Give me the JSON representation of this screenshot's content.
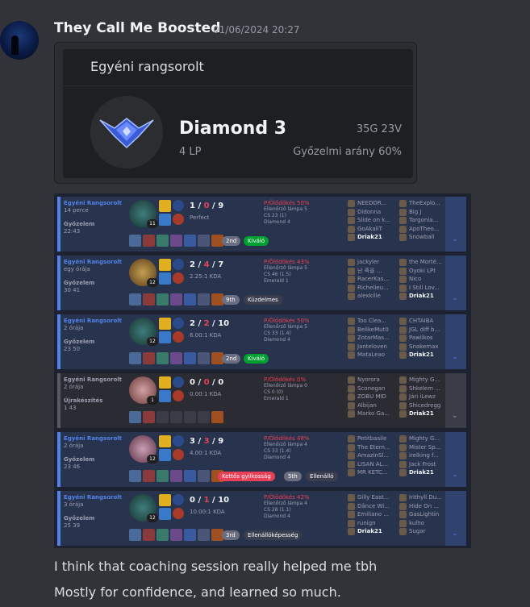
{
  "message": {
    "author": "They Call Me Boosted",
    "timestamp": "01/06/2024 20:27",
    "lines": [
      "I think that coaching session really helped me tbh",
      "Mostly for confidence, and learned so much."
    ]
  },
  "embed": {
    "title": "Egyéni rangsorolt",
    "tier": "Diamond 3",
    "lp": "4 LP",
    "games": "35G 23V",
    "winrate": "Győzelmi arány 60%"
  },
  "colors": {
    "win_accent": "#5383e8",
    "loss_accent": "#59595e",
    "badge_green": "#00a030",
    "kp_red": "#e84057"
  },
  "matches": [
    {
      "queue": "Egyéni Rangsorolt",
      "ago": "14 perce",
      "result": "Győzelem",
      "duration": "22:43",
      "level": "11",
      "k": "1",
      "d": "0",
      "a": "9",
      "ratio": "Perfect",
      "place": "2nd",
      "tag": "Kiváló",
      "tag_style": "green",
      "kp": "P/Ölődökés 50%",
      "line1": "Ellenőrző lámpa 5",
      "line2": "CS 23 (1)",
      "line3": "Diamond 4",
      "team1": [
        "NEEDDR...",
        "Didonna",
        "Slide on k...",
        "GoAkaliT",
        "Driak21"
      ],
      "team2": [
        "TheExplo...",
        "Big J",
        "Targonia...",
        "ApoTheo...",
        "Snowball"
      ]
    },
    {
      "queue": "Egyéni Rangsorolt",
      "ago": "egy órája",
      "result": "Győzelem",
      "duration": "30 41",
      "level": "12",
      "k": "2",
      "d": "4",
      "a": "7",
      "ratio": "2.25:1 KDA",
      "place": "9th",
      "tag": "Küzdelmes",
      "tag_style": "gray",
      "kp": "P/Ölődökés 43%",
      "line1": "Ellenőrző lámpa 5",
      "line2": "CS 46 (1.5)",
      "line3": "Emerald 1",
      "team1": [
        "jackyler",
        "난 죽을 ...",
        "RacerKas...",
        "Richelieu...",
        "alexkille"
      ],
      "team2": [
        "the Morté...",
        "Oyoki LPt",
        "Nico",
        "I Still Lov...",
        "Driak21"
      ]
    },
    {
      "queue": "Egyéni Rangsorolt",
      "ago": "2 órája",
      "result": "Győzelem",
      "duration": "23 50",
      "level": "12",
      "k": "2",
      "d": "2",
      "a": "10",
      "ratio": "6.00:1 KDA",
      "place": "2nd",
      "tag": "Kiváló",
      "tag_style": "green",
      "kp": "P/Ölődökés 50%",
      "line1": "Ellenőrző lámpa 5",
      "line2": "CS 33 (1.4)",
      "line3": "Diamond 4",
      "team1": [
        "Too Clea...",
        "BelikeMut0",
        "ZotarMas...",
        "Janteloven",
        "MataLeao"
      ],
      "team2": [
        "CHTAIBA",
        "JGL diff b...",
        "Pawlikos",
        "Snakemax",
        "Driak21"
      ]
    },
    {
      "queue": "Egyéni Rangsorolt",
      "ago": "2 órája",
      "result": "Újrakészítés",
      "duration": "1 43",
      "level": "1",
      "k": "0",
      "d": "0",
      "a": "0",
      "ratio": "0.00:1 KDA",
      "place": "",
      "tag": "",
      "tag_style": "",
      "kp": "P/Ölődökés 0%",
      "line1": "Ellenőrző lámpa 0",
      "line2": "CS 0 (0)",
      "line3": "Emerald 1",
      "team1": [
        "Nyorora",
        "Sconegan",
        "ZOBU MID",
        "Albijan",
        "Marko Ga..."
      ],
      "team2": [
        "Mighty G...",
        "Shkelem ...",
        "Jári iLewz",
        "Shicedregg",
        "Driak21"
      ]
    },
    {
      "queue": "Egyéni Rangsorolt",
      "ago": "2 órája",
      "result": "Győzelem",
      "duration": "23 46",
      "level": "12",
      "k": "3",
      "d": "3",
      "a": "9",
      "ratio": "4.00:1 KDA",
      "place": "5th",
      "tag": "Kettős gyilkosság",
      "tag_style": "red",
      "tag2": "Ellenálló",
      "kp": "P/Ölődökés 48%",
      "line1": "Ellenőrző lámpa 4",
      "line2": "CS 33 (1.4)",
      "line3": "Diamond 4",
      "team1": [
        "Petitbasile",
        "The Etern...",
        "AmazinSl...",
        "LISAN AL...",
        "MR KETC..."
      ],
      "team2": [
        "Mighty G...",
        "Mister Sp...",
        "irelking f...",
        "Jack Frost",
        "Driak21"
      ]
    },
    {
      "queue": "Egyéni Rangsorolt",
      "ago": "3 órája",
      "result": "Győzelem",
      "duration": "25 39",
      "level": "12",
      "k": "0",
      "d": "1",
      "a": "10",
      "ratio": "10.00:1 KDA",
      "place": "3rd",
      "tag": "Ellenállóképesség",
      "tag_style": "gray",
      "kp": "P/Ölődökés 42%",
      "line1": "Ellenőrző lámpa 4",
      "line2": "CS 28 (1.1)",
      "line3": "Diamond 4",
      "team1": [
        "Gilly East...",
        "Dânce Wi...",
        "Emiliano ...",
        "runign",
        "Driak21"
      ],
      "team2": [
        "Irithyll Du...",
        "Hide On ...",
        "GasLightin",
        "kulho",
        "Sugar"
      ]
    }
  ]
}
